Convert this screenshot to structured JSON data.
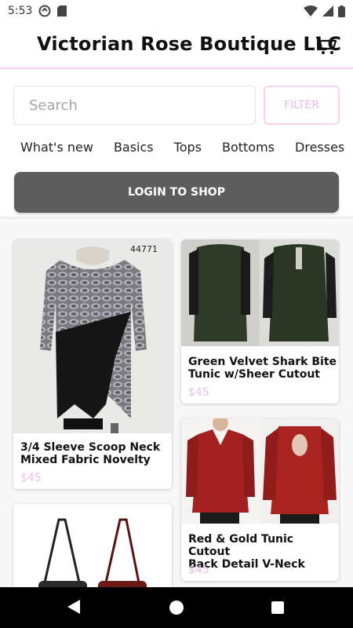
{
  "status_bar": {
    "time": "5:53"
  },
  "header": {
    "title": "Victorian Rose Boutique LLC"
  },
  "search": {
    "placeholder": "Search",
    "filter_label": "FILTER"
  },
  "tabs": [
    "What's new",
    "Basics",
    "Tops",
    "Bottoms",
    "Dresses"
  ],
  "login": {
    "label": "LOGIN TO SHOP"
  },
  "products": [
    {
      "name_line1": "3/4 Sleeve Scoop Neck",
      "name_line2": "Mixed Fabric Novelty",
      "price": "$45",
      "sku": "44771"
    },
    {
      "name_line1": "Green Velvet Shark Bite",
      "name_line2": "Tunic w/Sheer Cutout",
      "price": "$45"
    },
    {
      "name_line1": "Red & Gold Tunic Cutout",
      "name_line2": "Back Detail V-Neck",
      "price": "$45"
    }
  ],
  "colors": {
    "accent_pink": "#f5cdee",
    "price_pink": "#f3bce8",
    "login_bg": "#5d5d5d"
  }
}
